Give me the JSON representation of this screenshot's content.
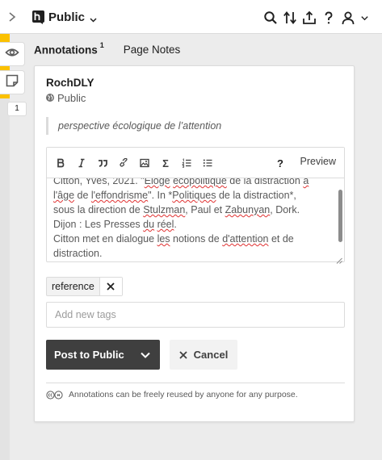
{
  "header": {
    "group_name": "Public",
    "icons": [
      "collapse-sidebar-icon",
      "hypothesis-logo-icon",
      "chevron-down-icon",
      "search-icon",
      "sort-icon",
      "share-icon",
      "help-icon",
      "user-icon",
      "chevron-down-icon"
    ]
  },
  "rail": {
    "annotation_count": "1"
  },
  "tabs": [
    {
      "label": "Annotations",
      "count": "1",
      "active": true
    },
    {
      "label": "Page Notes",
      "count": "",
      "active": false
    }
  ],
  "annotation": {
    "author": "RochDLY",
    "group": "Public",
    "quote": "perspective écologique de l’attention"
  },
  "editor": {
    "toolbar": [
      "bold-icon",
      "italic-icon",
      "quote-icon",
      "link-icon",
      "image-icon",
      "math-icon",
      "numbered-list-icon",
      "bullet-list-icon",
      "help-icon"
    ],
    "math_symbol": "Σ",
    "help_symbol": "?",
    "preview_label": "Preview",
    "text_segments": [
      {
        "t": "Citton, Yves, 2021. \"",
        "sp": false
      },
      {
        "t": "Eloge",
        "sp": true
      },
      {
        "t": " ",
        "sp": false
      },
      {
        "t": "écopolitique",
        "sp": true
      },
      {
        "t": " de la distraction ",
        "sp": false
      },
      {
        "t": "à",
        "sp": true
      },
      {
        "t": "\n",
        "sp": false
      },
      {
        "t": "l'âge",
        "sp": true
      },
      {
        "t": " de ",
        "sp": false
      },
      {
        "t": "l'effondrisme",
        "sp": true
      },
      {
        "t": "\". In *",
        "sp": false
      },
      {
        "t": "Politiques",
        "sp": true
      },
      {
        "t": " de la distraction*,\nsous la direction de ",
        "sp": false
      },
      {
        "t": "Stulzman",
        "sp": true
      },
      {
        "t": ", Paul et ",
        "sp": false
      },
      {
        "t": "Zabunyan",
        "sp": true
      },
      {
        "t": ", Dork.\nDijon : Les Presses ",
        "sp": false
      },
      {
        "t": "du",
        "sp": true
      },
      {
        "t": " ",
        "sp": false
      },
      {
        "t": "réel",
        "sp": true
      },
      {
        "t": ".\nCitton met en dialogue ",
        "sp": false
      },
      {
        "t": "les",
        "sp": true
      },
      {
        "t": " notions de ",
        "sp": false
      },
      {
        "t": "d'attention",
        "sp": true
      },
      {
        "t": " et de\ndistraction.",
        "sp": false
      }
    ]
  },
  "tags": {
    "items": [
      "reference"
    ],
    "placeholder": "Add new tags"
  },
  "actions": {
    "post_label": "Post to Public",
    "cancel_label": "Cancel"
  },
  "license": {
    "text": "Annotations can be freely reused by anyone for any purpose."
  },
  "colors": {
    "accent_yellow": "#fbc100",
    "post_button": "#3f3f3f",
    "spellcheck": "#e03030"
  }
}
